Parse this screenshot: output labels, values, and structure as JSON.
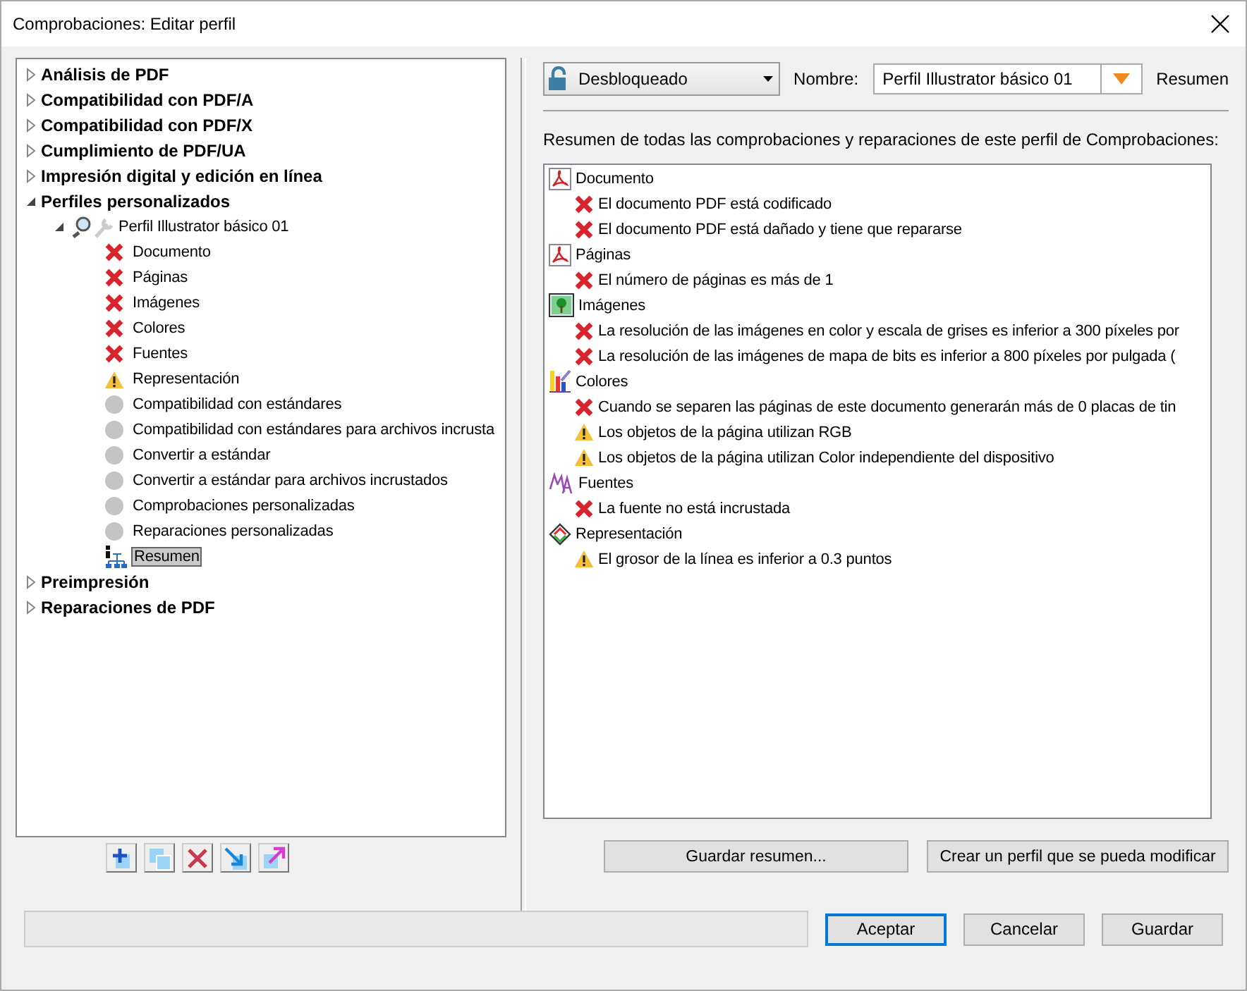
{
  "window": {
    "title": "Comprobaciones: Editar perfil"
  },
  "tree": [
    {
      "label": "Análisis de PDF",
      "expanded": false
    },
    {
      "label": "Compatibilidad con PDF/A",
      "expanded": false
    },
    {
      "label": "Compatibilidad con PDF/X",
      "expanded": false
    },
    {
      "label": "Cumplimiento de PDF/UA",
      "expanded": false
    },
    {
      "label": "Impresión digital y edición en línea",
      "expanded": false
    },
    {
      "label": "Perfiles personalizados",
      "expanded": true,
      "children": [
        {
          "label": "Perfil Illustrator básico 01",
          "expanded": true,
          "children": [
            {
              "label": "Documento",
              "kind": "error",
              "selected": false
            },
            {
              "label": "Páginas",
              "kind": "error",
              "selected": false
            },
            {
              "label": "Imágenes",
              "kind": "error",
              "selected": false
            },
            {
              "label": "Colores",
              "kind": "error",
              "selected": false
            },
            {
              "label": "Fuentes",
              "kind": "error",
              "selected": false
            },
            {
              "label": "Representación",
              "kind": "warning",
              "selected": false
            },
            {
              "label": "Compatibilidad con estándares",
              "kind": "none",
              "selected": false
            },
            {
              "label": "Compatibilidad con estándares para archivos incrusta",
              "kind": "none",
              "selected": false
            },
            {
              "label": "Convertir a estándar",
              "kind": "none",
              "selected": false
            },
            {
              "label": "Convertir a estándar para archivos incrustados",
              "kind": "none",
              "selected": false
            },
            {
              "label": "Comprobaciones personalizadas",
              "kind": "none",
              "selected": false
            },
            {
              "label": "Reparaciones personalizadas",
              "kind": "none",
              "selected": false
            },
            {
              "label": "Resumen",
              "kind": "summary",
              "selected": true
            }
          ]
        }
      ]
    },
    {
      "label": "Preimpresión",
      "expanded": false
    },
    {
      "label": "Reparaciones de PDF",
      "expanded": false
    }
  ],
  "lock_dropdown": {
    "value": "Desbloqueado"
  },
  "name_label": "Nombre:",
  "name_field": {
    "value": "Perfil Illustrator básico 01"
  },
  "section_title": "Resumen",
  "description": "Resumen de todas las comprobaciones y reparaciones de este perfil de Comprobaciones:",
  "summary": [
    {
      "label": "Documento",
      "kind": "pdf",
      "items": [
        {
          "text": "El documento PDF está codificado",
          "kind": "error"
        },
        {
          "text": "El documento PDF está dañado y tiene que repararse",
          "kind": "error"
        }
      ]
    },
    {
      "label": "Páginas",
      "kind": "pdf",
      "items": [
        {
          "text": "El número de páginas es más de 1",
          "kind": "error"
        }
      ]
    },
    {
      "label": "Imágenes",
      "kind": "image",
      "items": [
        {
          "text": "La resolución de las imágenes en color y escala de grises es inferior a 300 píxeles por",
          "kind": "error"
        },
        {
          "text": "La resolución de las imágenes de mapa de bits es inferior a 800 píxeles por pulgada (",
          "kind": "error"
        }
      ]
    },
    {
      "label": "Colores",
      "kind": "colors",
      "items": [
        {
          "text": "Cuando se separen las páginas de este documento generarán más de 0 placas de tin",
          "kind": "error"
        },
        {
          "text": "Los objetos de la página utilizan RGB",
          "kind": "warning"
        },
        {
          "text": "Los objetos de la página utilizan Color independiente del dispositivo",
          "kind": "warning"
        }
      ]
    },
    {
      "label": "Fuentes",
      "kind": "fonts",
      "items": [
        {
          "text": "La fuente no está incrustada",
          "kind": "error"
        }
      ]
    },
    {
      "label": "Representación",
      "kind": "render",
      "items": [
        {
          "text": "El grosor de la línea es inferior a 0.3 puntos",
          "kind": "warning"
        }
      ]
    }
  ],
  "panel_buttons": [
    "Guardar resumen...",
    "Crear un perfil que se pueda modificar"
  ],
  "tree_tools": [
    {
      "kind": "add"
    },
    {
      "kind": "duplicate"
    },
    {
      "kind": "delete"
    },
    {
      "kind": "import"
    },
    {
      "kind": "export"
    }
  ],
  "dialog_buttons": [
    {
      "label": "Aceptar",
      "default": true
    },
    {
      "label": "Cancelar",
      "default": false
    },
    {
      "label": "Guardar",
      "default": false
    }
  ]
}
